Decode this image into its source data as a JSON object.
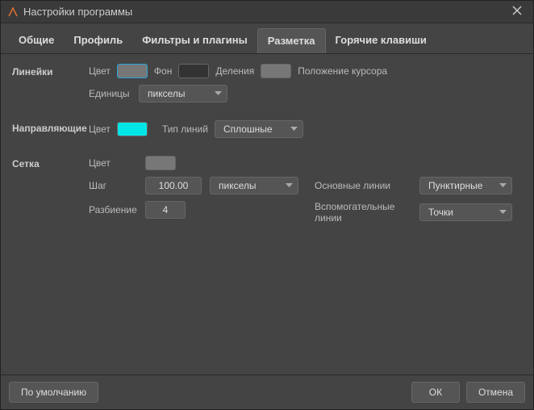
{
  "window": {
    "title": "Настройки программы"
  },
  "tabs": [
    {
      "label": "Общие"
    },
    {
      "label": "Профиль"
    },
    {
      "label": "Фильтры и плагины"
    },
    {
      "label": "Разметка",
      "active": true
    },
    {
      "label": "Горячие клавиши"
    }
  ],
  "rulers": {
    "section": "Линейки",
    "color_label": "Цвет",
    "color_value": "#777777",
    "bg_label": "Фон",
    "bg_value": "#333333",
    "divisions_label": "Деления",
    "divisions_value": "#777777",
    "cursor_label": "Положение курсора",
    "units_label": "Единицы",
    "units_value": "пикселы"
  },
  "guides": {
    "section": "Направляющие",
    "color_label": "Цвет",
    "color_value": "#00e5e5",
    "linetype_label": "Тип линий",
    "linetype_value": "Сплошные"
  },
  "grid": {
    "section": "Сетка",
    "color_label": "Цвет",
    "color_value": "#777777",
    "step_label": "Шаг",
    "step_value": "100.00",
    "step_units": "пикселы",
    "subdiv_label": "Разбиение",
    "subdiv_value": "4",
    "main_lines_label": "Основные линии",
    "main_lines_value": "Пунктирные",
    "aux_lines_label": "Вспомогательные линии",
    "aux_lines_value": "Точки"
  },
  "footer": {
    "defaults": "По умолчанию",
    "ok": "ОК",
    "cancel": "Отмена"
  }
}
